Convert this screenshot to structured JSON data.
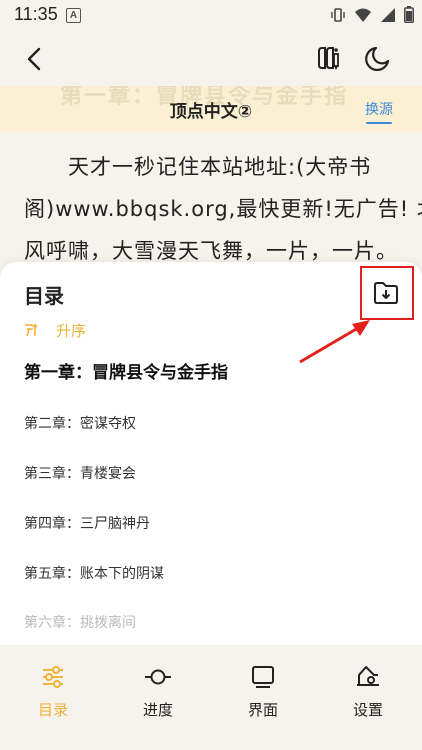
{
  "status_bar": {
    "time": "11:35",
    "notification_icon": "A"
  },
  "header": {
    "back_icon": "chevron-left-icon",
    "book_icon": "bookmark-book-icon",
    "theme_icon": "moon-icon"
  },
  "source_bar": {
    "ghost_title": "第一章：冒牌县令与金手指",
    "source_name": "顶点中文②",
    "switch_label": "换源"
  },
  "reader": {
    "lines": [
      "　　天才一秒记住本站地址:(大帝书",
      "阁)www.bbqsk.org,最快更新!无广告! 北",
      "风呼啸，大雪漫天飞舞，一片，一片。"
    ]
  },
  "toc": {
    "title": "目录",
    "sort_label": "升序",
    "current_chapter": "第一章：冒牌县令与金手指",
    "chapters": [
      "第二章：密谋夺权",
      "第三章：青楼宴会",
      "第四章：三尸脑神丹",
      "第五章：账本下的阴谋",
      "第六章：挑拨离间"
    ]
  },
  "bottom_nav": {
    "items": [
      {
        "label": "目录",
        "icon": "toc-sliders-icon",
        "active": true
      },
      {
        "label": "进度",
        "icon": "progress-icon",
        "active": false
      },
      {
        "label": "界面",
        "icon": "display-icon",
        "active": false
      },
      {
        "label": "设置",
        "icon": "settings-icon",
        "active": false
      }
    ]
  },
  "colors": {
    "accent": "#f0b23a",
    "link": "#3a8be0",
    "highlight": "#e2211c",
    "background": "#f6f3ec"
  }
}
